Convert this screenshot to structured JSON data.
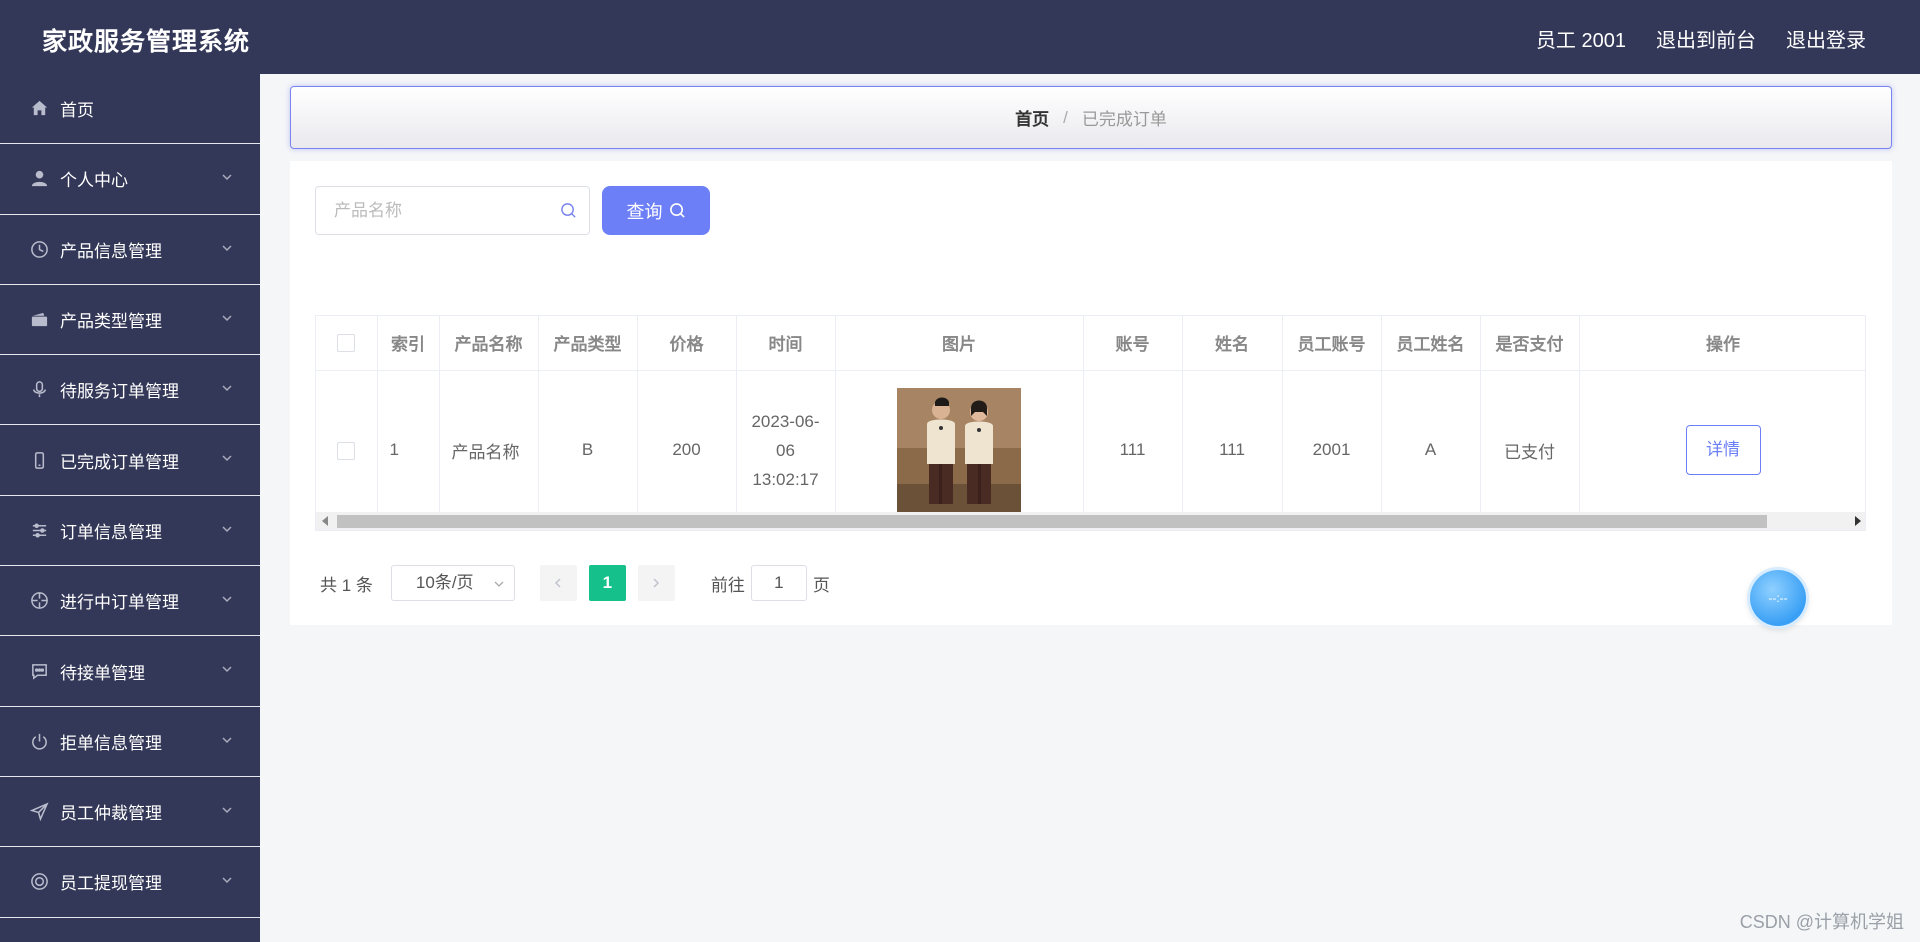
{
  "app": {
    "title": "家政服务管理系统"
  },
  "header": {
    "links": [
      "员工 2001",
      "退出到前台",
      "退出登录"
    ]
  },
  "sidebar": {
    "items": [
      {
        "label": "首页",
        "icon": "home-icon"
      },
      {
        "label": "个人中心",
        "icon": "user-icon"
      },
      {
        "label": "产品信息管理",
        "icon": "clock-icon"
      },
      {
        "label": "产品类型管理",
        "icon": "wallet-icon"
      },
      {
        "label": "待服务订单管理",
        "icon": "microphone-icon"
      },
      {
        "label": "已完成订单管理",
        "icon": "mobile-icon"
      },
      {
        "label": "订单信息管理",
        "icon": "sliders-icon"
      },
      {
        "label": "进行中订单管理",
        "icon": "aperture-icon"
      },
      {
        "label": "待接单管理",
        "icon": "chat-dots-icon"
      },
      {
        "label": "拒单信息管理",
        "icon": "power-icon"
      },
      {
        "label": "员工仲裁管理",
        "icon": "send-icon"
      },
      {
        "label": "员工提现管理",
        "icon": "lifebuoy-icon"
      }
    ]
  },
  "breadcrumb": {
    "home": "首页",
    "separator": "/",
    "current": "已完成订单"
  },
  "search": {
    "placeholder": "产品名称",
    "value": "",
    "button_label": "查询"
  },
  "table": {
    "columns": [
      "索引",
      "产品名称",
      "产品类型",
      "价格",
      "时间",
      "图片",
      "账号",
      "姓名",
      "员工账号",
      "员工姓名",
      "是否支付",
      "操作"
    ],
    "rows": [
      {
        "index": "1",
        "product_name": "产品名称",
        "product_type": "B",
        "price": "200",
        "time": "2023-06-06 13:02:17",
        "account": "111",
        "name": "111",
        "staff_account": "2001",
        "staff_name": "A",
        "paid": "已支付",
        "action": "详情"
      }
    ]
  },
  "pagination": {
    "total_text": "共 1 条",
    "page_size": "10条/页",
    "current_page": "1",
    "goto_label": "前往",
    "goto_value": "1",
    "page_suffix": "页"
  },
  "float_widget": {
    "text": "--:--"
  },
  "watermark": "CSDN @计算机学姐",
  "colors": {
    "sidebar_bg": "#343858",
    "accent": "#6d7ff6",
    "pager_active": "#15c08a",
    "content_bg": "#f5f6f8"
  }
}
